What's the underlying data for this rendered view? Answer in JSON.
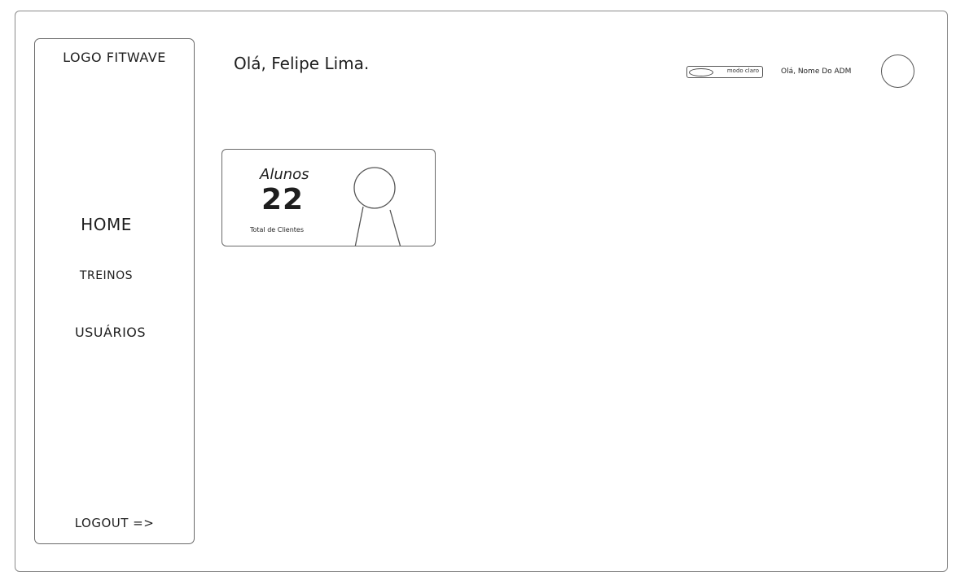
{
  "sidebar": {
    "logo": "LOGO FITWAVE",
    "items": [
      {
        "label": "HOME"
      },
      {
        "label": "TREINOS"
      },
      {
        "label": "USUÁRIOS"
      }
    ],
    "logout": "LOGOUT =>"
  },
  "header": {
    "greeting": "Olá, Felipe Lima.",
    "theme_toggle_label": "modo claro",
    "admin_name": "Olá, Nome Do ADM"
  },
  "cards": [
    {
      "title": "Alunos",
      "value": "22",
      "caption": "Total de Clientes",
      "icon": "person-icon"
    }
  ]
}
